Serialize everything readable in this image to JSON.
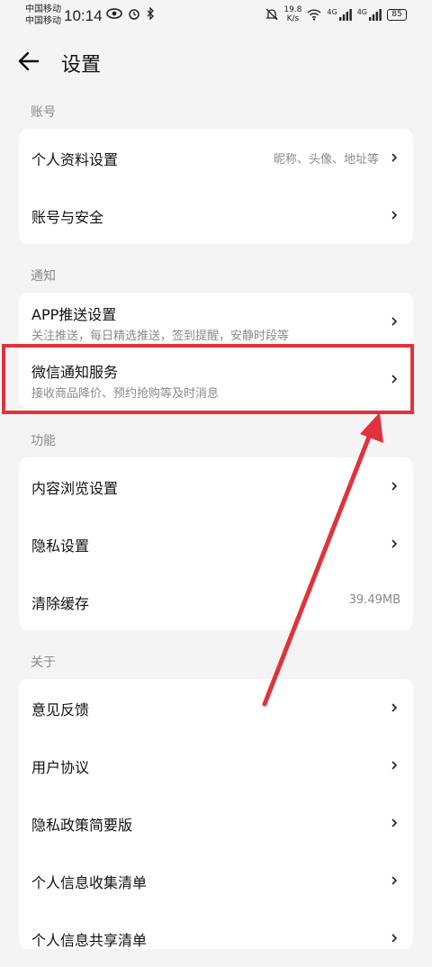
{
  "status": {
    "carrier1": "中国移动",
    "carrier2": "中国移动",
    "time": "10:14",
    "speed_value": "19.8",
    "speed_unit": "K/s",
    "net1": "4G",
    "net2": "4G",
    "battery": "85"
  },
  "header": {
    "title": "设置"
  },
  "sections": {
    "account": {
      "label": "账号",
      "items": [
        {
          "label": "个人资料设置",
          "value": "昵称、头像、地址等"
        },
        {
          "label": "账号与安全"
        }
      ]
    },
    "notify": {
      "label": "通知",
      "items": [
        {
          "label": "APP推送设置",
          "sub": "关注推送，每日精选推送，签到提醒，安静时段等"
        },
        {
          "label": "微信通知服务",
          "sub": "接收商品降价、预约抢购等及时消息"
        }
      ]
    },
    "function": {
      "label": "功能",
      "items": [
        {
          "label": "内容浏览设置"
        },
        {
          "label": "隐私设置"
        },
        {
          "label": "清除缓存",
          "value": "39.49MB"
        }
      ]
    },
    "about": {
      "label": "关于",
      "items": [
        {
          "label": "意见反馈"
        },
        {
          "label": "用户协议"
        },
        {
          "label": "隐私政策简要版"
        },
        {
          "label": "个人信息收集清单"
        },
        {
          "label": "个人信息共享清单"
        }
      ]
    }
  },
  "colors": {
    "annotation": "#e0333b",
    "background": "#f4f4f4"
  }
}
